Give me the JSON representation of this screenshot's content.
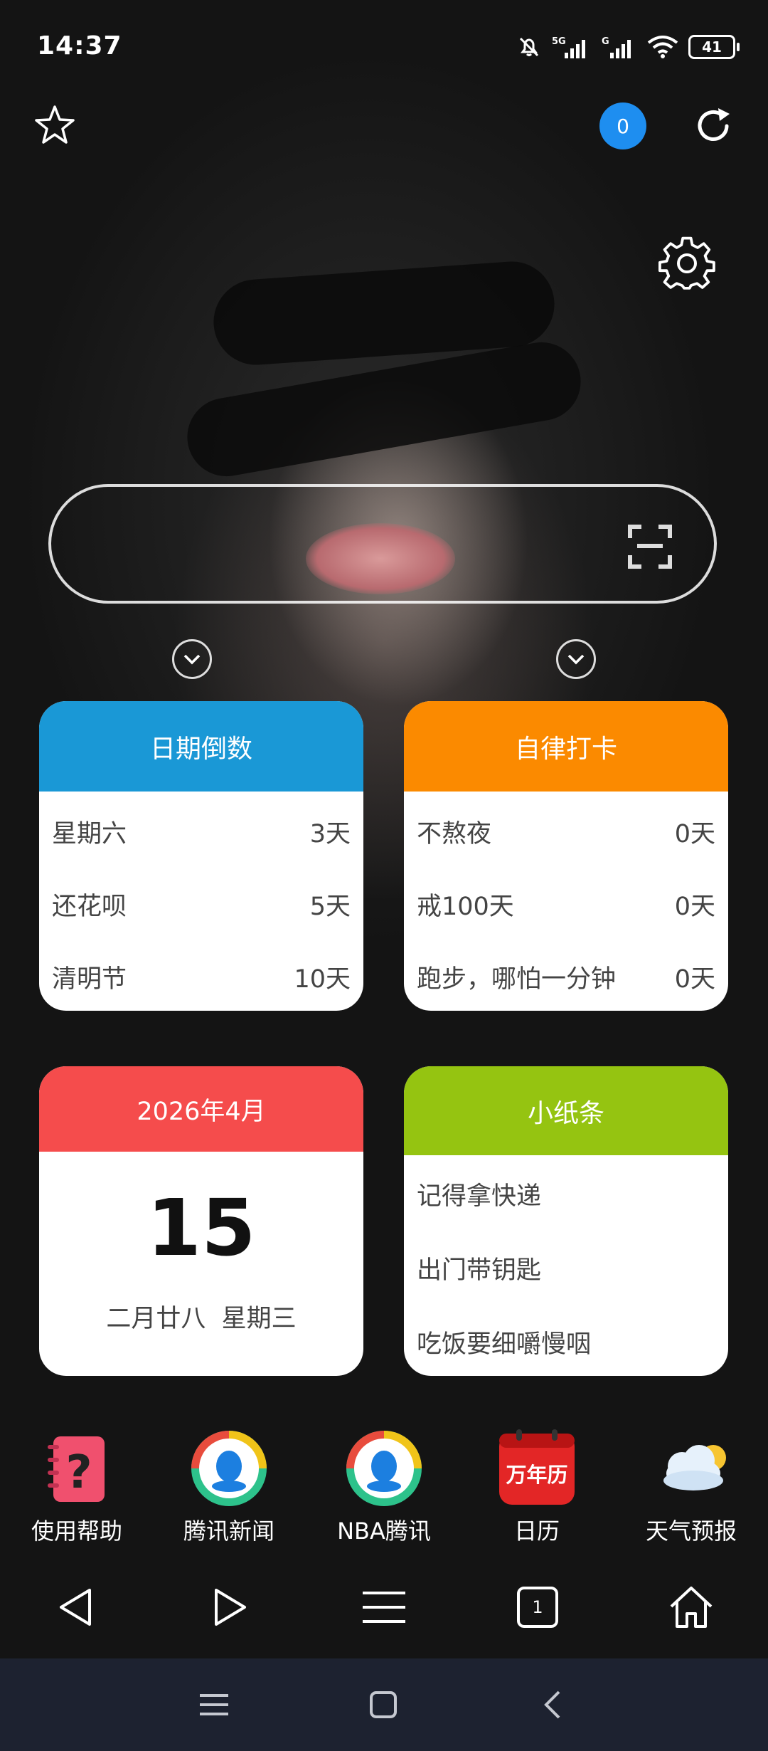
{
  "status_bar": {
    "time": "14:37",
    "battery": "41",
    "network_1": "5G",
    "network_2": "G"
  },
  "top": {
    "notification_count": "0"
  },
  "search": {
    "placeholder": ""
  },
  "cards": {
    "countdown": {
      "title": "日期倒数",
      "header_color": "#1a98d6",
      "rows": [
        {
          "label": "星期六",
          "value": "3天"
        },
        {
          "label": "还花呗",
          "value": "5天"
        },
        {
          "label": "清明节",
          "value": "10天"
        }
      ]
    },
    "checkin": {
      "title": "自律打卡",
      "header_color": "#fb8a00",
      "rows": [
        {
          "label": "不熬夜",
          "value": "0天"
        },
        {
          "label": "戒100天",
          "value": "0天"
        },
        {
          "label": "跑步，哪怕一分钟",
          "value": "0天"
        }
      ]
    },
    "calendar": {
      "title": "2026年4月",
      "header_color": "#f54c4c",
      "day": "15",
      "subtitle": "二月廿八  星期三"
    },
    "notes": {
      "title": "小纸条",
      "header_color": "#95c411",
      "items": [
        "记得拿快递",
        "出门带钥匙",
        "吃饭要细嚼慢咽"
      ]
    }
  },
  "shortcuts": [
    {
      "label": "使用帮助",
      "icon": "help-notebook-icon"
    },
    {
      "label": "腾讯新闻",
      "icon": "tencent-news-icon"
    },
    {
      "label": "NBA腾讯",
      "icon": "tencent-nba-icon"
    },
    {
      "label": "日历",
      "icon": "wannianli-calendar-icon",
      "icon_text": "万年历"
    },
    {
      "label": "天气预报",
      "icon": "weather-cloud-icon"
    }
  ],
  "toolbar": {
    "tab_count": "1"
  }
}
